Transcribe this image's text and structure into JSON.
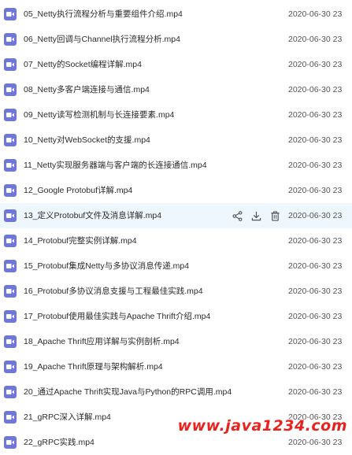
{
  "files": [
    {
      "name": "05_Netty执行流程分析与重要组件介绍.mp4",
      "date": "2020-06-30 23"
    },
    {
      "name": "06_Netty回调与Channel执行流程分析.mp4",
      "date": "2020-06-30 23"
    },
    {
      "name": "07_Netty的Socket编程详解.mp4",
      "date": "2020-06-30 23"
    },
    {
      "name": "08_Netty多客户端连接与通信.mp4",
      "date": "2020-06-30 23"
    },
    {
      "name": "09_Netty读写检测机制与长连接要素.mp4",
      "date": "2020-06-30 23"
    },
    {
      "name": "10_Netty对WebSocket的支援.mp4",
      "date": "2020-06-30 23"
    },
    {
      "name": "11_Netty实现服务器端与客户端的长连接通信.mp4",
      "date": "2020-06-30 23"
    },
    {
      "name": "12_Google Protobuf详解.mp4",
      "date": "2020-06-30 23"
    },
    {
      "name": "13_定义Protobuf文件及消息详解.mp4",
      "date": "2020-06-30 23",
      "hovered": true
    },
    {
      "name": "14_Protobuf完整实例详解.mp4",
      "date": "2020-06-30 23"
    },
    {
      "name": "15_Protobuf集成Netty与多协议消息传递.mp4",
      "date": "2020-06-30 23"
    },
    {
      "name": "16_Protobuf多协议消息支援与工程最佳实践.mp4",
      "date": "2020-06-30 23"
    },
    {
      "name": "17_Protobuf使用最佳实践与Apache Thrift介绍.mp4",
      "date": "2020-06-30 23"
    },
    {
      "name": "18_Apache Thrift应用详解与实例剖析.mp4",
      "date": "2020-06-30 23"
    },
    {
      "name": "19_Apache Thrift原理与架构解析.mp4",
      "date": "2020-06-30 23"
    },
    {
      "name": "20_通过Apache Thrift实现Java与Python的RPC调用.mp4",
      "date": "2020-06-30 23"
    },
    {
      "name": "21_gRPC深入详解.mp4",
      "date": "2020-06-30 23"
    },
    {
      "name": "22_gRPC实践.mp4",
      "date": "2020-06-30 23"
    }
  ],
  "file_icon": "video-file-icon",
  "row_actions": [
    "share-icon",
    "download-icon",
    "delete-icon"
  ],
  "watermark": "www.java1234.com",
  "colors": {
    "icon": "#6f78d8",
    "hover": "#eef7fe",
    "watermark": "#e8231e"
  }
}
